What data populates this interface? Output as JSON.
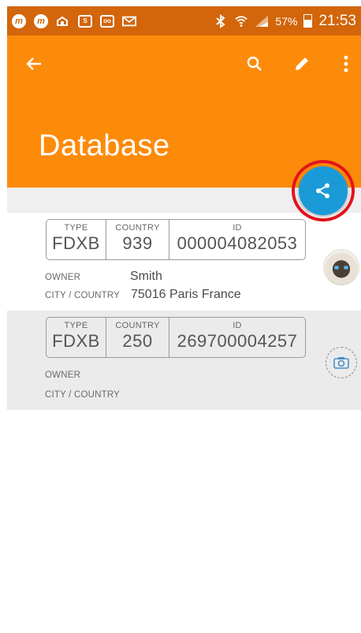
{
  "status_bar": {
    "battery": "57%",
    "time": "21:53"
  },
  "app_bar": {
    "title": "Database",
    "color": "#fd8b0a"
  },
  "fab": {
    "icon": "share-icon",
    "color": "#1a9bd8"
  },
  "records": [
    {
      "type_label": "TYPE",
      "type": "FDXB",
      "country_label": "COUNTRY",
      "country": "939",
      "id_label": "ID",
      "id": "000004082053",
      "owner_label": "OWNER",
      "owner": "Smith",
      "city_label": "CITY / COUNTRY",
      "city": "75016 Paris France"
    },
    {
      "type_label": "TYPE",
      "type": "FDXB",
      "country_label": "COUNTRY",
      "country": "250",
      "id_label": "ID",
      "id": "269700004257",
      "owner_label": "OWNER",
      "owner": "",
      "city_label": "CITY / COUNTRY",
      "city": ""
    }
  ]
}
